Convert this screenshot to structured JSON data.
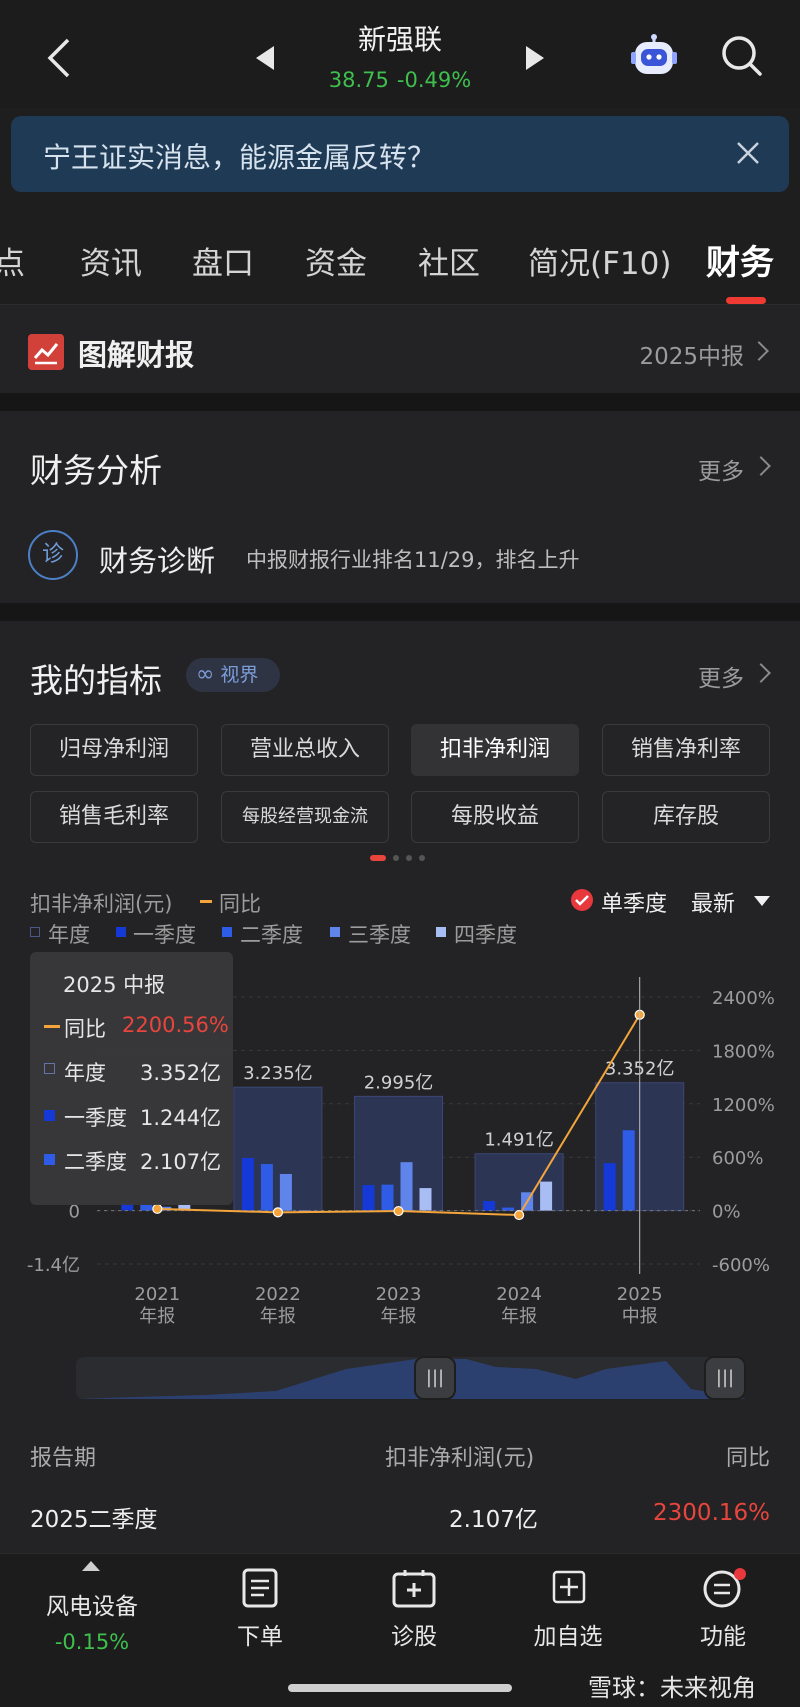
{
  "header": {
    "stock_name": "新强联",
    "price": "38.75",
    "change": "-0.49%"
  },
  "banner": {
    "text": "宁王证实消息，能源金属反转？"
  },
  "tabs": [
    {
      "label": "点"
    },
    {
      "label": "资讯"
    },
    {
      "label": "盘口"
    },
    {
      "label": "资金"
    },
    {
      "label": "社区"
    },
    {
      "label": "简况(F10)"
    },
    {
      "label": "财务",
      "active": true
    }
  ],
  "report": {
    "title": "图解财报",
    "period": "2025中报"
  },
  "analysis": {
    "title": "财务分析",
    "more": "更多",
    "diag_icon": "诊",
    "diag_title": "财务诊断",
    "diag_desc": "中报财报行业排名11/29，排名上升"
  },
  "indicators": {
    "title": "我的指标",
    "badge": "视界",
    "more": "更多",
    "chips": [
      "归母净利润",
      "营业总收入",
      "扣非净利润",
      "销售净利率",
      "销售毛利率",
      "每股经营现金流",
      "每股收益",
      "库存股"
    ],
    "active_chip": "扣非净利润"
  },
  "chart_controls": {
    "metric_label": "扣非净利润(元)",
    "yoy_legend": "同比",
    "single_quarter": "单季度",
    "latest": "最新",
    "legend": [
      "年度",
      "一季度",
      "二季度",
      "三季度",
      "四季度"
    ]
  },
  "chart_data": {
    "type": "bar",
    "categories": [
      "2021\n年报",
      "2022\n年报",
      "2023\n年报",
      "2024\n年报",
      "2025\n中报"
    ],
    "category_lines": [
      [
        "2021",
        "年报"
      ],
      [
        "2022",
        "年报"
      ],
      [
        "2023",
        "年报"
      ],
      [
        "2024",
        "年报"
      ],
      [
        "2025",
        "中报"
      ]
    ],
    "left_axis_ticks": [
      "0",
      "-1.4亿"
    ],
    "left_axis_values": [
      0,
      -1.4
    ],
    "right_axis_ticks": [
      "2400%",
      "1800%",
      "1200%",
      "600%",
      "0%",
      "-600%"
    ],
    "right_axis_values": [
      2400,
      1800,
      1200,
      600,
      0,
      -600
    ],
    "ylim_left": [
      -1.4,
      5.6
    ],
    "ylim_right": [
      -600,
      2400
    ],
    "annual_labels": [
      "3.235亿",
      "2.995亿",
      "1.491亿",
      "3.352亿"
    ],
    "series": [
      {
        "name": "年度",
        "values": [
          null,
          3.235,
          2.995,
          1.491,
          3.352
        ]
      },
      {
        "name": "一季度",
        "values": [
          0.2,
          1.38,
          0.67,
          0.25,
          1.244
        ]
      },
      {
        "name": "二季度",
        "values": [
          0.15,
          1.22,
          0.68,
          0.08,
          2.107
        ]
      },
      {
        "name": "三季度",
        "values": [
          0.1,
          0.96,
          1.27,
          0.48,
          null
        ]
      },
      {
        "name": "四季度",
        "values": [
          0.15,
          -0.05,
          0.59,
          0.76,
          null
        ]
      }
    ],
    "yoy": {
      "name": "同比",
      "values": [
        20,
        -20,
        -5,
        -50,
        2200.56
      ]
    }
  },
  "tooltip": {
    "title": "2025 中报",
    "yoy_label": "同比",
    "yoy_value": "2200.56%",
    "annual_label": "年度",
    "annual_value": "3.352亿",
    "q1_label": "一季度",
    "q1_value": "1.244亿",
    "q2_label": "二季度",
    "q2_value": "2.107亿"
  },
  "table": {
    "col_period": "报告期",
    "col_value": "扣非净利润(元)",
    "col_yoy": "同比",
    "row_period": "2025二季度",
    "row_value": "2.107亿",
    "row_yoy": "2300.16%"
  },
  "bottom_bar": {
    "sector_name": "风电设备",
    "sector_change": "-0.15%",
    "order": "下单",
    "diagnose": "诊股",
    "add_watch": "加自选",
    "functions": "功能"
  },
  "watermark": "雪球：未来视角",
  "colors": {
    "up_red": "#e8453c",
    "down_green": "#3fbf4d",
    "accent_orange": "#f3a43b",
    "bar_annual": "#2c3554",
    "bar_q1": "#1439d6",
    "bar_q2": "#2e5ce6",
    "bar_q3": "#6085ea",
    "bar_q4": "#a9bdf5"
  }
}
